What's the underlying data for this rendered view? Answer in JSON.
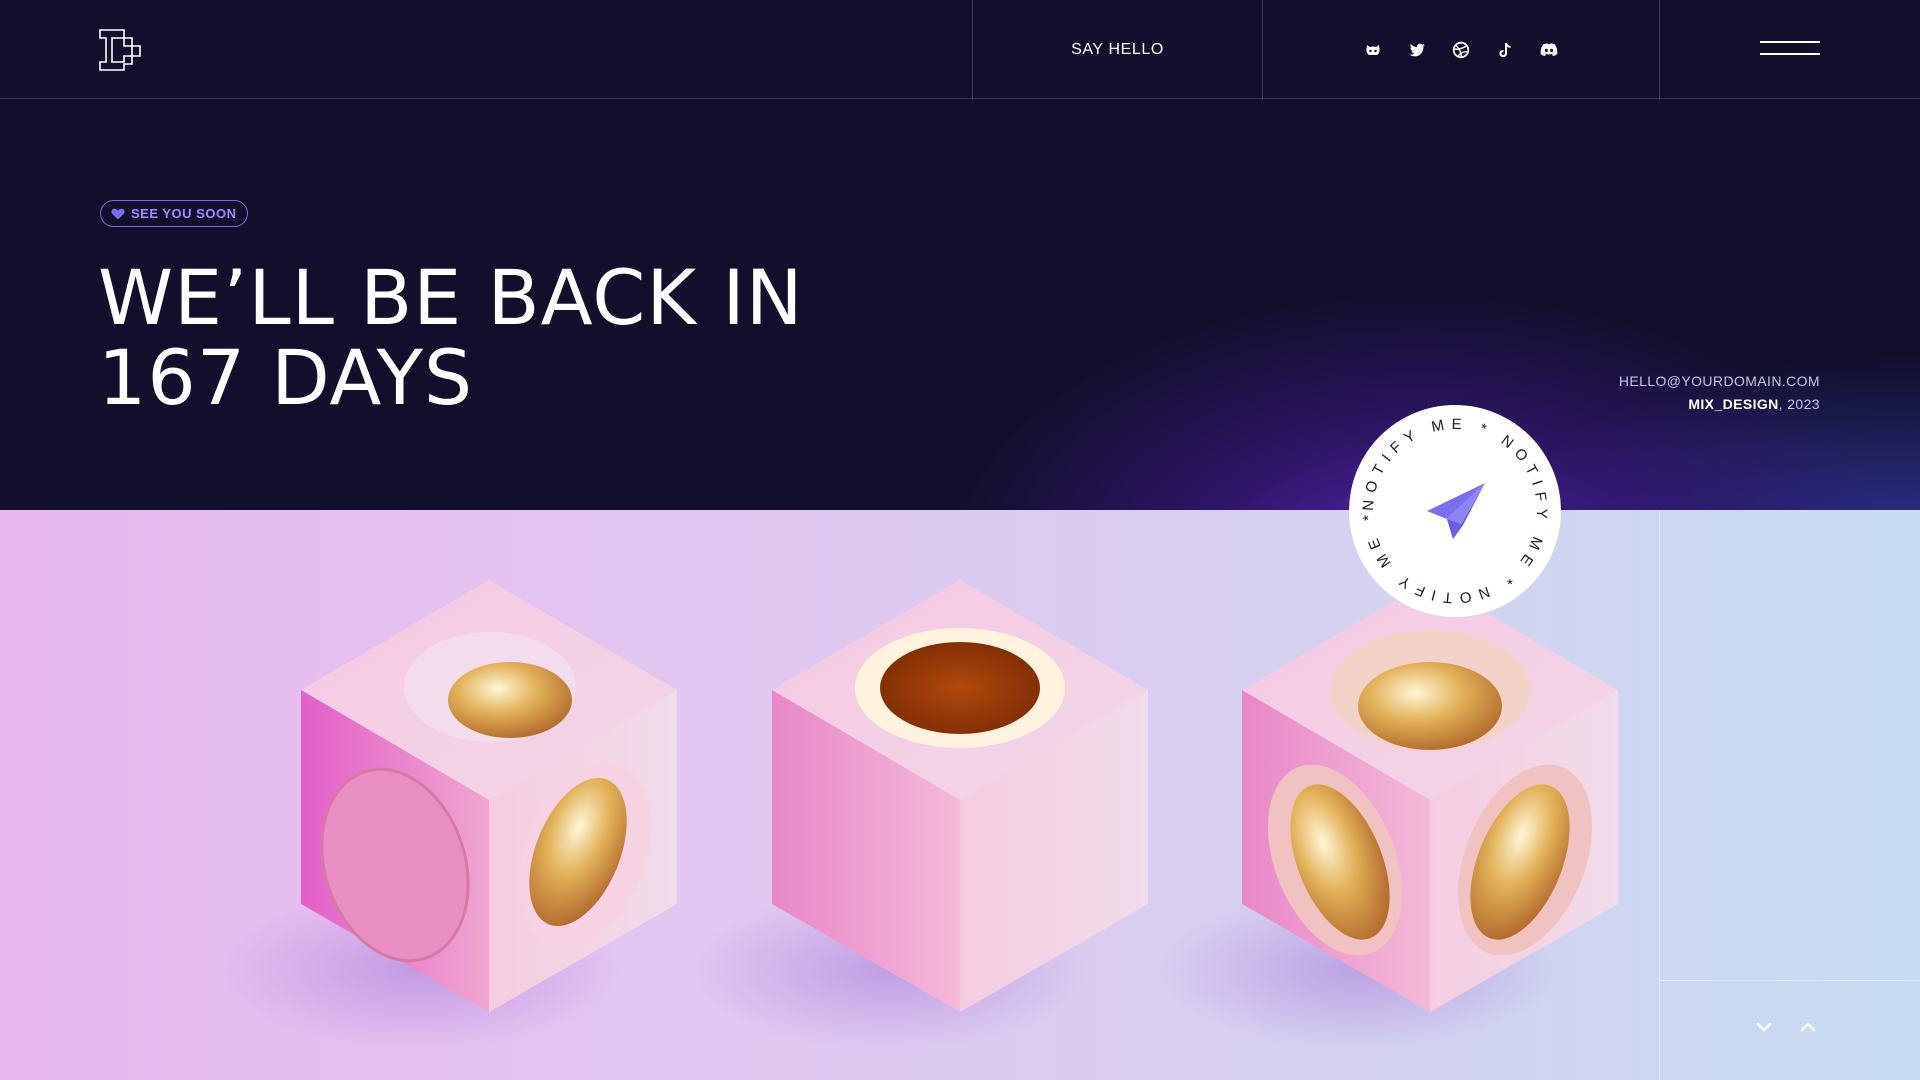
{
  "header": {
    "logo_icon": "logo-icon",
    "say_hello_label": "SAY HELLO",
    "social_icons": [
      "github-icon",
      "twitter-icon",
      "dribbble-icon",
      "tiktok-icon",
      "discord-icon"
    ],
    "menu_icon": "hamburger-menu-icon"
  },
  "hero": {
    "badge_icon": "heart-icon",
    "badge_label": "SEE YOU SOON",
    "headline_line1": "WE’LL BE BACK IN",
    "headline_line2": "167 DAYS",
    "email": "HELLO@YOURDOMAIN.COM",
    "brand": "MIX_DESIGN",
    "year_suffix": ", 2023"
  },
  "notify": {
    "ring_text": "NOTIFY ME * NOTIFY ME * NOTIFY ME * ",
    "icon": "paper-plane-icon"
  },
  "scene": {
    "image_description": "three-pink-cubes-with-gold-spheres",
    "scroll_down_icon": "chevron-down-icon",
    "scroll_up_icon": "chevron-up-icon"
  },
  "colors": {
    "background_dark": "#110f2b",
    "accent_purple": "#7c6cf0",
    "glow_purple": "#6028c8",
    "text_white": "#ffffff"
  }
}
